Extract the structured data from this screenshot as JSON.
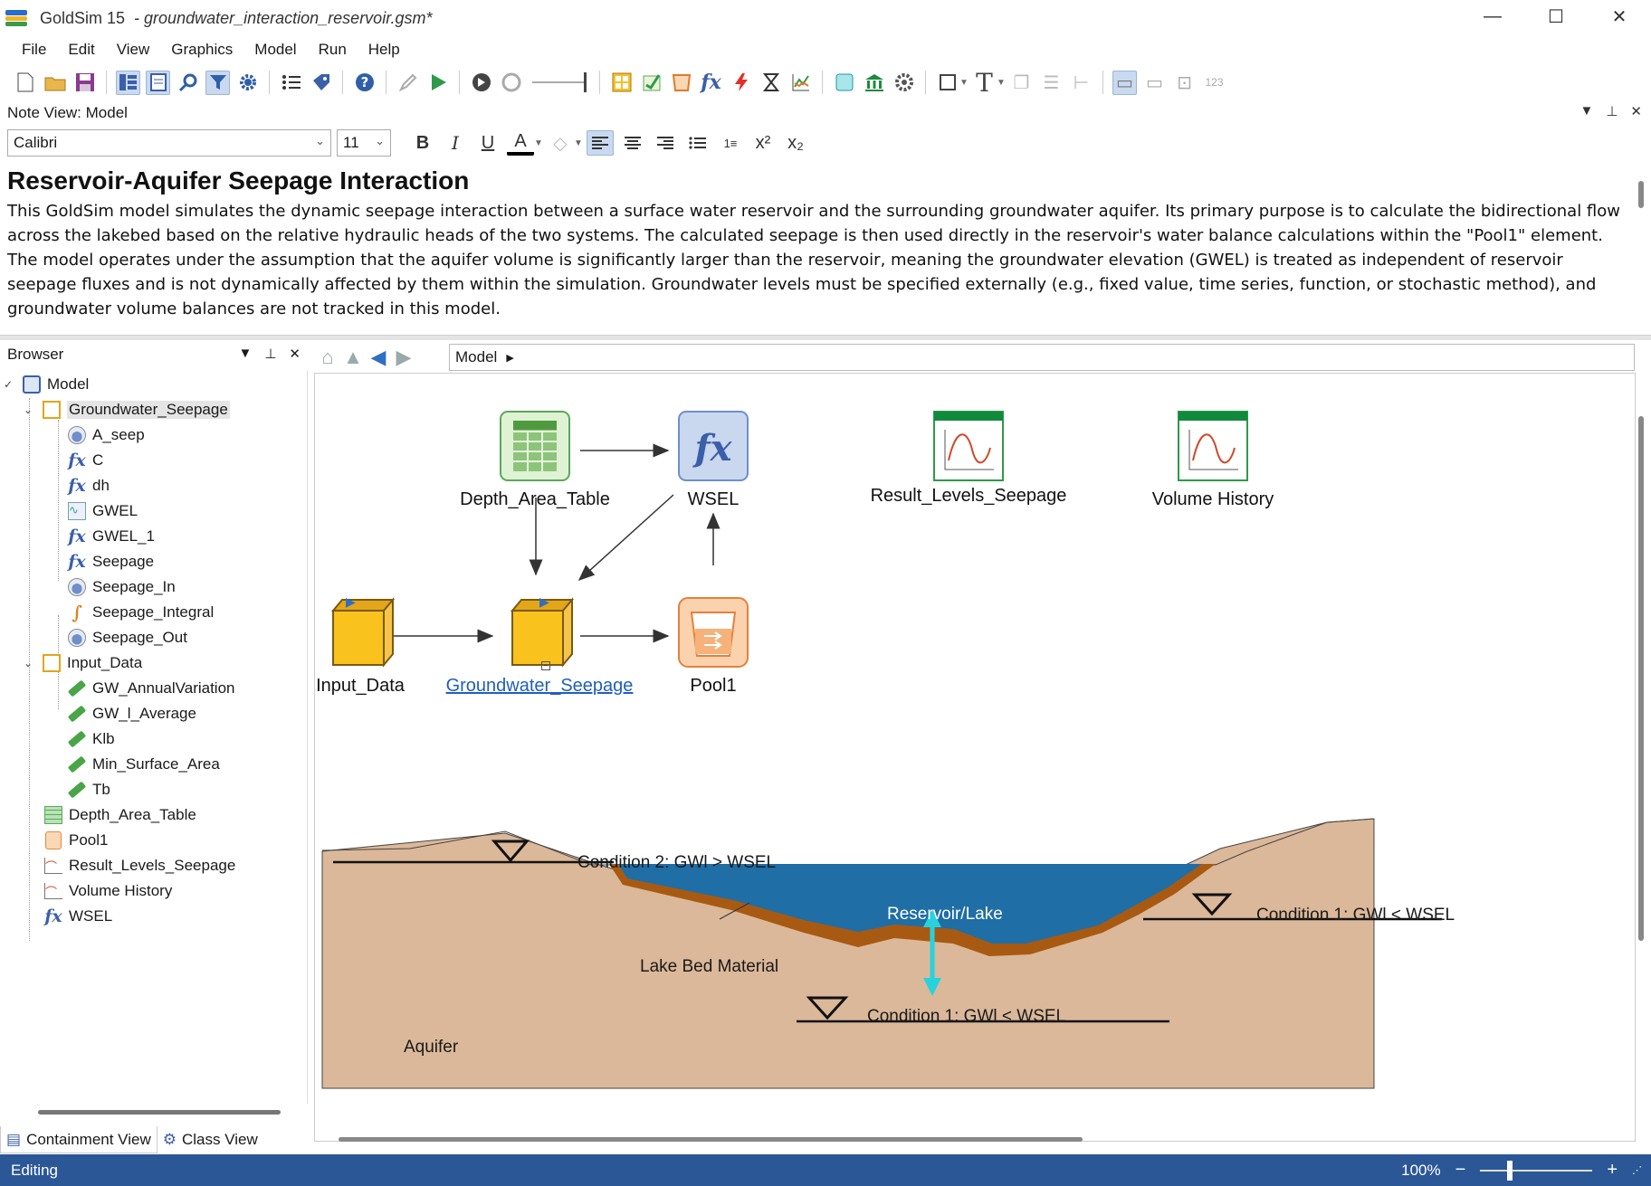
{
  "window": {
    "app_name": "GoldSim 15",
    "file_name": "- groundwater_interaction_reservoir.gsm*",
    "minimize": "—",
    "maximize": "☐",
    "close": "✕"
  },
  "menu": [
    "File",
    "Edit",
    "View",
    "Graphics",
    "Model",
    "Run",
    "Help"
  ],
  "toolbar": {
    "icons": [
      "new-file-icon",
      "open-folder-icon",
      "save-icon",
      "browser-toggle-icon",
      "note-icon",
      "find-icon",
      "filter-icon",
      "options-gear-icon",
      "list-icon",
      "tag-icon",
      "help-icon",
      "edit-mode-icon",
      "run-icon",
      "step-icon",
      "reset-icon",
      "container-icon",
      "data-icon",
      "pool-icon",
      "function-icon",
      "event-icon",
      "timer-icon",
      "result-icon",
      "database-icon",
      "library-icon",
      "settings-icon",
      "graphics-frame-icon",
      "text-icon"
    ]
  },
  "note_view": {
    "header": "Note View: Model",
    "font_name": "Calibri",
    "font_size": "11",
    "title": "Reservoir-Aquifer Seepage Interaction",
    "body": "This GoldSim model simulates the dynamic seepage interaction between a surface water reservoir and the surrounding groundwater aquifer. Its primary purpose is to calculate the bidirectional flow across the lakebed based on the relative hydraulic heads of the two systems. The calculated seepage is then used directly in the reservoir's water balance calculations within the \"Pool1\" element. The model operates under the assumption that the aquifer volume is significantly larger than the reservoir, meaning the groundwater elevation (GWEL) is treated as independent of reservoir seepage fluxes and is not dynamically affected by them within the simulation. Groundwater levels must be specified externally (e.g., fixed value, time series, function, or stochastic method), and groundwater volume balances are not tracked in this model."
  },
  "browser": {
    "header": "Browser",
    "tree": {
      "root": "Model",
      "groundwater_seepage": {
        "label": "Groundwater_Seepage",
        "children": [
          "A_seep",
          "C",
          "dh",
          "GWEL",
          "GWEL_1",
          "Seepage",
          "Seepage_In",
          "Seepage_Integral",
          "Seepage_Out"
        ]
      },
      "input_data": {
        "label": "Input_Data",
        "children": [
          "GW_AnnualVariation",
          "GW_l_Average",
          "Klb",
          "Min_Surface_Area",
          "Tb"
        ]
      },
      "others": [
        "Depth_Area_Table",
        "Pool1",
        "Result_Levels_Seepage",
        "Volume History",
        "WSEL"
      ]
    },
    "tabs": [
      "Containment View",
      "Class View"
    ]
  },
  "graphics": {
    "path": "Model",
    "nodes": {
      "depth_area_table": "Depth_Area_Table",
      "wsel": "WSEL",
      "result_levels": "Result_Levels_Seepage",
      "volume_history": "Volume History",
      "input_data": "Input_Data",
      "groundwater_seepage": "Groundwater_Seepage",
      "pool1": "Pool1"
    },
    "diagram": {
      "condition2": "Condition 2: GWl > WSEL",
      "condition1_right": "Condition 1: GWl < WSEL",
      "condition1_bottom": "Condition 1: GWl < WSEL",
      "reservoir": "Reservoir/Lake",
      "lake_bed": "Lake Bed Material",
      "aquifer": "Aquifer",
      "colors": {
        "soil": "#dbb899",
        "water": "#1f6ea6",
        "lake_bed": "#a85a12",
        "arrow": "#2ad4e0"
      }
    }
  },
  "status": {
    "mode": "Editing",
    "zoom": "100%",
    "zoom_out": "−",
    "zoom_in": "+"
  }
}
